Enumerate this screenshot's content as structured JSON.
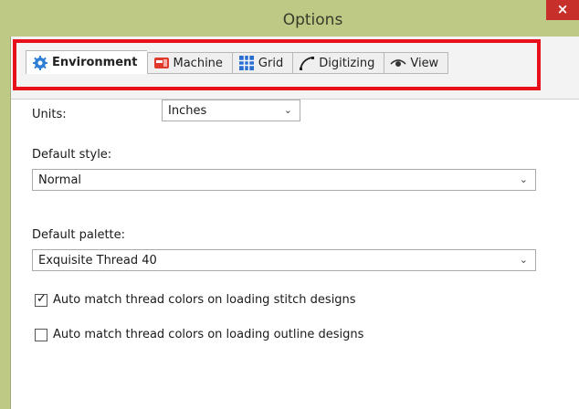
{
  "window": {
    "title": "Options",
    "close_glyph": "×"
  },
  "tabs": [
    {
      "label": "Environment",
      "icon": "gear-icon",
      "active": true
    },
    {
      "label": "Machine",
      "icon": "sewing-machine-icon",
      "active": false
    },
    {
      "label": "Grid",
      "icon": "grid-icon",
      "active": false
    },
    {
      "label": "Digitizing",
      "icon": "curve-pen-icon",
      "active": false
    },
    {
      "label": "View",
      "icon": "eye-icon",
      "active": false
    }
  ],
  "environment": {
    "units_label": "Units:",
    "units_value": "Inches",
    "default_style_label": "Default style:",
    "default_style_value": "Normal",
    "default_palette_label": "Default palette:",
    "default_palette_value": "Exquisite Thread 40",
    "auto_match_stitch_label": "Auto match thread colors on loading stitch designs",
    "auto_match_stitch_checked": true,
    "auto_match_outline_label": "Auto match thread colors on loading outline designs",
    "auto_match_outline_checked": false,
    "chevron_glyph": "⌄",
    "check_glyph": "✓"
  },
  "colors": {
    "frame": "#bdc985",
    "close": "#c7302a",
    "highlight": "#e8101a",
    "gear": "#2f7fd6",
    "machine": "#e0392b",
    "grid": "#2a6fd0"
  }
}
